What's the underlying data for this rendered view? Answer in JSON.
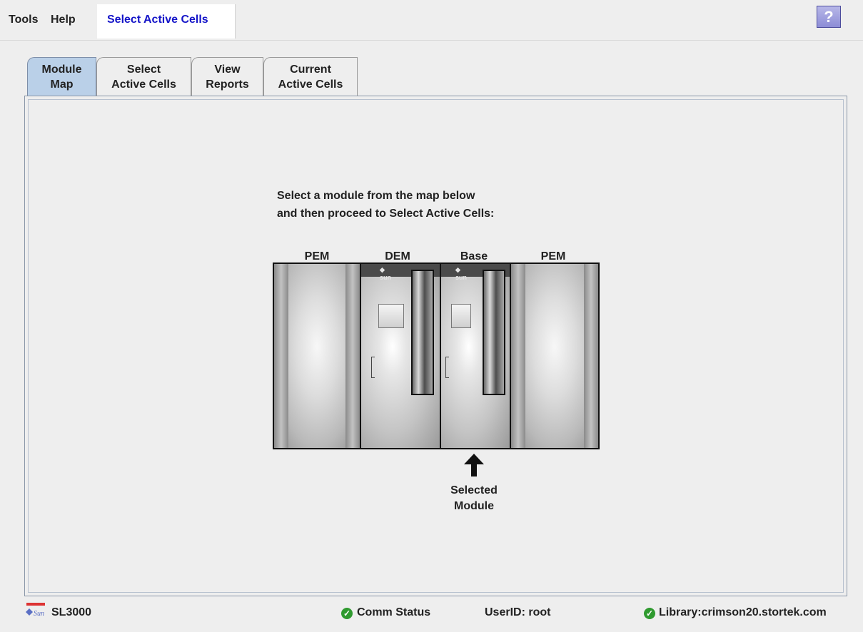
{
  "menubar": {
    "tools_label": "Tools",
    "help_label": "Help",
    "active_label": "Select Active Cells",
    "help_button": "?"
  },
  "tabs": [
    {
      "line1": "Module",
      "line2": "Map",
      "active": true
    },
    {
      "line1": "Select",
      "line2": "Active Cells",
      "active": false
    },
    {
      "line1": "View",
      "line2": "Reports",
      "active": false
    },
    {
      "line1": "Current",
      "line2": "Active Cells",
      "active": false
    }
  ],
  "main": {
    "instruction_line1": "Select a module from the map below",
    "instruction_line2": "and then proceed to Select Active Cells:",
    "modules": [
      "PEM",
      "DEM",
      "Base",
      "PEM"
    ],
    "selected_line1": "Selected",
    "selected_line2": "Module"
  },
  "footer": {
    "product": "SL3000",
    "comm_status": "Comm Status",
    "user": "UserID: root",
    "library": "Library:crimson20.stortek.com"
  },
  "colors": {
    "active_menu": "#1414c8",
    "active_tab": "#bad0e8",
    "status_ok": "#2f9a2f",
    "help_button": "#8d8dd6"
  }
}
